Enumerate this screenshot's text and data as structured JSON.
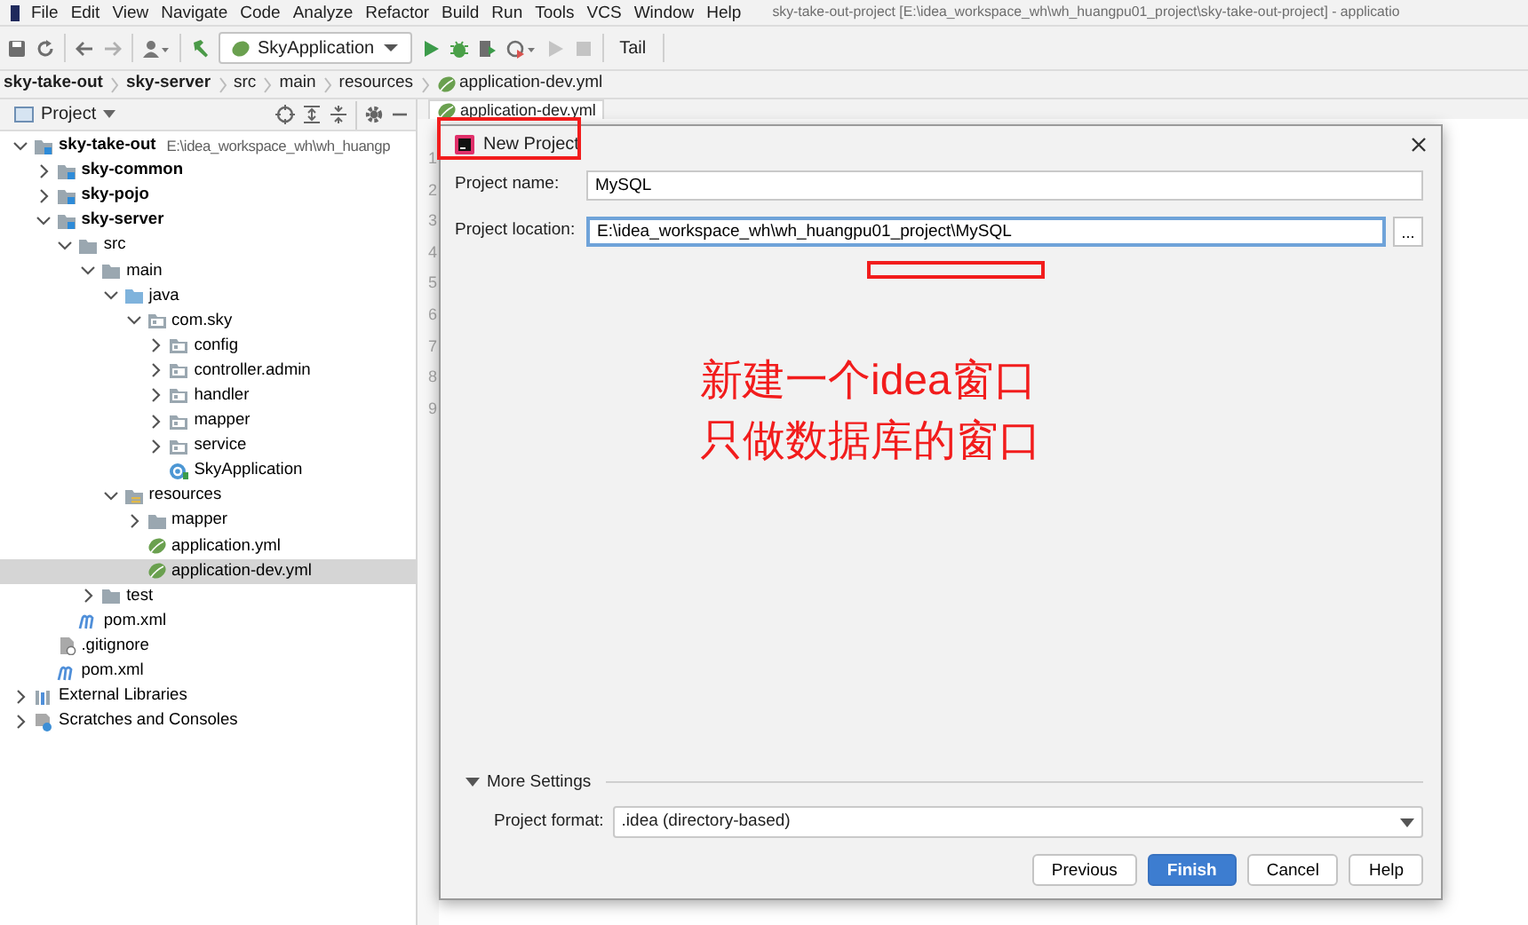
{
  "menu": [
    "File",
    "Edit",
    "View",
    "Navigate",
    "Code",
    "Analyze",
    "Refactor",
    "Build",
    "Run",
    "Tools",
    "VCS",
    "Window",
    "Help"
  ],
  "window_title": "sky-take-out-project [E:\\idea_workspace_wh\\wh_huangpu01_project\\sky-take-out-project] - applicatio",
  "toolbar": {
    "run_config": "SkyApplication",
    "tail": "Tail"
  },
  "breadcrumb": [
    {
      "label": "sky-take-out",
      "kind": "module"
    },
    {
      "label": "sky-server",
      "kind": "module"
    },
    {
      "label": "src",
      "kind": "folder"
    },
    {
      "label": "main",
      "kind": "folder"
    },
    {
      "label": "resources",
      "kind": "folder"
    },
    {
      "label": "application-dev.yml",
      "kind": "yml"
    }
  ],
  "project_panel": {
    "title": "Project",
    "tree": [
      {
        "label": "sky-take-out",
        "kind": "module",
        "path": "E:\\idea_workspace_wh\\wh_huangp",
        "expanded": true,
        "selected": false,
        "children": [
          {
            "label": "sky-common",
            "kind": "module",
            "expanded": false,
            "selected": false
          },
          {
            "label": "sky-pojo",
            "kind": "module",
            "expanded": false,
            "selected": false
          },
          {
            "label": "sky-server",
            "kind": "module",
            "expanded": true,
            "selected": false,
            "children": [
              {
                "label": "src",
                "kind": "folder",
                "expanded": true,
                "selected": false,
                "children": [
                  {
                    "label": "main",
                    "kind": "folder",
                    "expanded": true,
                    "selected": false,
                    "children": [
                      {
                        "label": "java",
                        "kind": "source",
                        "expanded": true,
                        "selected": false,
                        "children": [
                          {
                            "label": "com.sky",
                            "kind": "package",
                            "expanded": true,
                            "selected": false,
                            "children": [
                              {
                                "label": "config",
                                "kind": "package",
                                "expanded": false,
                                "selected": false
                              },
                              {
                                "label": "controller.admin",
                                "kind": "package",
                                "expanded": false,
                                "selected": false
                              },
                              {
                                "label": "handler",
                                "kind": "package",
                                "expanded": false,
                                "selected": false
                              },
                              {
                                "label": "mapper",
                                "kind": "package",
                                "expanded": false,
                                "selected": false
                              },
                              {
                                "label": "service",
                                "kind": "package",
                                "expanded": false,
                                "selected": false
                              },
                              {
                                "label": "SkyApplication",
                                "kind": "class",
                                "selected": false
                              }
                            ]
                          }
                        ]
                      },
                      {
                        "label": "resources",
                        "kind": "resources",
                        "expanded": true,
                        "selected": false,
                        "children": [
                          {
                            "label": "mapper",
                            "kind": "folder",
                            "expanded": false,
                            "selected": false
                          },
                          {
                            "label": "application.yml",
                            "kind": "yml",
                            "selected": false
                          },
                          {
                            "label": "application-dev.yml",
                            "kind": "yml",
                            "selected": true
                          }
                        ]
                      }
                    ]
                  },
                  {
                    "label": "test",
                    "kind": "folder",
                    "expanded": false,
                    "selected": false
                  }
                ]
              },
              {
                "label": "pom.xml",
                "kind": "maven",
                "selected": false
              }
            ]
          },
          {
            "label": ".gitignore",
            "kind": "gitignore",
            "selected": false
          },
          {
            "label": "pom.xml",
            "kind": "maven",
            "selected": false
          }
        ]
      },
      {
        "label": "External Libraries",
        "kind": "libraries",
        "expanded": false,
        "selected": false
      },
      {
        "label": "Scratches and Consoles",
        "kind": "scratches",
        "expanded": false,
        "selected": false
      }
    ]
  },
  "editor": {
    "tab": "application-dev.yml",
    "line_numbers": [
      "1",
      "2",
      "3",
      "4",
      "5",
      "6",
      "7",
      "8",
      "9"
    ]
  },
  "dialog": {
    "title": "New Project",
    "fields": [
      {
        "label": "Project name:",
        "value": "MySQL",
        "focused": false,
        "browse": false
      },
      {
        "label": "Project location:",
        "value": "E:\\idea_workspace_wh\\wh_huangpu01_project\\MySQL",
        "focused": true,
        "browse": true,
        "browse_label": "..."
      }
    ],
    "annotation": [
      "新建一个idea窗口",
      "只做数据库的窗口"
    ],
    "more_settings": {
      "label": "More Settings",
      "expanded": true,
      "format_label": "Project format:",
      "format_value": ".idea (directory-based)"
    },
    "buttons": [
      {
        "label": "Previous",
        "primary": false
      },
      {
        "label": "Finish",
        "primary": true
      },
      {
        "label": "Cancel",
        "primary": false
      },
      {
        "label": "Help",
        "primary": false
      }
    ]
  }
}
